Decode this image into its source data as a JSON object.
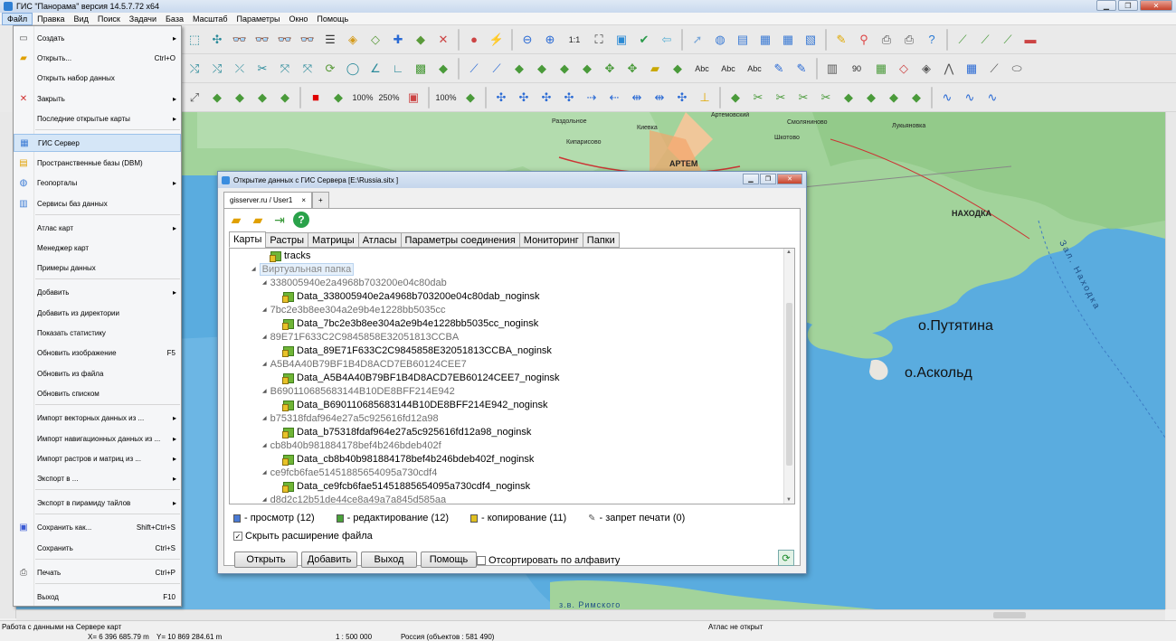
{
  "window": {
    "title": "ГИС \"Панорама\" версия 14.5.7.72 x64"
  },
  "menubar": [
    "Файл",
    "Правка",
    "Вид",
    "Поиск",
    "Задачи",
    "База",
    "Масштаб",
    "Параметры",
    "Окно",
    "Помощь"
  ],
  "file_menu": {
    "items": [
      {
        "label": "Создать",
        "shortcut": "",
        "submenu": true,
        "icon": "document-icon"
      },
      {
        "label": "Открыть...",
        "shortcut": "Ctrl+O",
        "submenu": false,
        "icon": "folder-open-icon"
      },
      {
        "label": "Открыть набор данных",
        "shortcut": "",
        "submenu": false,
        "icon": ""
      },
      {
        "label": "Закрыть",
        "shortcut": "",
        "submenu": true,
        "icon": "close-icon"
      },
      {
        "label": "Последние открытые карты",
        "shortcut": "",
        "submenu": true,
        "icon": ""
      },
      {
        "label": "ГИС Сервер",
        "shortcut": "",
        "submenu": false,
        "icon": "gis-server-icon"
      },
      {
        "label": "Пространственные базы (DBM)",
        "shortcut": "",
        "submenu": false,
        "icon": "database-icon"
      },
      {
        "label": "Геопорталы",
        "shortcut": "",
        "submenu": true,
        "icon": "globe-icon"
      },
      {
        "label": "Сервисы баз данных",
        "shortcut": "",
        "submenu": false,
        "icon": "db-service-icon"
      },
      {
        "label": "Атлас карт",
        "shortcut": "",
        "submenu": true,
        "icon": ""
      },
      {
        "label": "Менеджер карт",
        "shortcut": "",
        "submenu": false,
        "icon": ""
      },
      {
        "label": "Примеры данных",
        "shortcut": "",
        "submenu": false,
        "icon": ""
      },
      {
        "label": "Добавить",
        "shortcut": "",
        "submenu": true,
        "icon": ""
      },
      {
        "label": "Добавить из директории",
        "shortcut": "",
        "submenu": false,
        "icon": ""
      },
      {
        "label": "Показать статистику",
        "shortcut": "",
        "submenu": false,
        "icon": ""
      },
      {
        "label": "Обновить изображение",
        "shortcut": "F5",
        "submenu": false,
        "icon": ""
      },
      {
        "label": "Обновить из файла",
        "shortcut": "",
        "submenu": false,
        "icon": ""
      },
      {
        "label": "Обновить списком",
        "shortcut": "",
        "submenu": false,
        "icon": ""
      },
      {
        "label": "Импорт векторных данных из ...",
        "shortcut": "",
        "submenu": true,
        "icon": ""
      },
      {
        "label": "Импорт навигационных данных из ...",
        "shortcut": "",
        "submenu": true,
        "icon": ""
      },
      {
        "label": "Импорт растров и матриц из ...",
        "shortcut": "",
        "submenu": true,
        "icon": ""
      },
      {
        "label": "Экспорт в ...",
        "shortcut": "",
        "submenu": true,
        "icon": ""
      },
      {
        "label": "Экспорт в пирамиду тайлов",
        "shortcut": "",
        "submenu": true,
        "icon": ""
      },
      {
        "label": "Сохранить как...",
        "shortcut": "Shift+Ctrl+S",
        "submenu": false,
        "icon": "save-icon"
      },
      {
        "label": "Сохранить",
        "shortcut": "Ctrl+S",
        "submenu": false,
        "icon": ""
      },
      {
        "label": "Печать",
        "shortcut": "Ctrl+P",
        "submenu": false,
        "icon": "printer-icon"
      },
      {
        "label": "Выход",
        "shortcut": "F10",
        "submenu": false,
        "icon": ""
      }
    ]
  },
  "toolbar": {
    "zoom_1to1": "1:1",
    "pct100": "100%",
    "pct250": "250%",
    "abc": "Abc",
    "num90": "90"
  },
  "map_labels": {
    "artem": "АРТЕМ",
    "nakhodka": "НАХОДКА",
    "putyatina": "о.Путятина",
    "askold": "о.Аскольд",
    "bay": "Зал. Находка",
    "artemovsky": "Артемовский",
    "smolyaninovo": "Смоляниново",
    "razdolnoe": "Раздольное",
    "kievka": "Киевка",
    "kiparisovo": "Кипарисово",
    "shkotovo": "Шкотово",
    "lukyanovka": "Лукьяновка",
    "rimsky": "з.в. Римского"
  },
  "dialog": {
    "title": "Открытие данных с ГИС Сервера [E:\\Russia.sitx ]",
    "tab": "gisserver.ru / User1",
    "tab_close": "×",
    "tab_plus": "+",
    "inner_tabs": [
      "Карты",
      "Растры",
      "Матрицы",
      "Атласы",
      "Параметры соединения",
      "Мониторинг",
      "Папки"
    ],
    "tree": {
      "tracks": "tracks",
      "virtual_folder": "Виртуальная папка",
      "groups": [
        {
          "folder": "338005940e2a4968b703200e04c80dab",
          "item": "Data_338005940e2a4968b703200e04c80dab_noginsk"
        },
        {
          "folder": "7bc2e3b8ee304a2e9b4e1228bb5035cc",
          "item": "Data_7bc2e3b8ee304a2e9b4e1228bb5035cc_noginsk"
        },
        {
          "folder": "89E71F633C2C9845858E32051813CCBA",
          "item": "Data_89E71F633C2C9845858E32051813CCBA_noginsk"
        },
        {
          "folder": "A5B4A40B79BF1B4D8ACD7EB60124CEE7",
          "item": "Data_A5B4A40B79BF1B4D8ACD7EB60124CEE7_noginsk"
        },
        {
          "folder": "B690110685683144B10DE8BFF214E942",
          "item": "Data_B690110685683144B10DE8BFF214E942_noginsk"
        },
        {
          "folder": "b75318fdaf964e27a5c925616fd12a98",
          "item": "Data_b75318fdaf964e27a5c925616fd12a98_noginsk"
        },
        {
          "folder": "cb8b40b981884178bef4b246bdeb402f",
          "item": "Data_cb8b40b981884178bef4b246bdeb402f_noginsk"
        },
        {
          "folder": "ce9fcb6fae51451885654095a730cdf4",
          "item": "Data_ce9fcb6fae51451885654095a730cdf4_noginsk"
        }
      ],
      "last_folder": "d8d2c12b51de44ce8a49a7a845d585aa"
    },
    "legend": {
      "view": "- просмотр (12)",
      "edit": "- редактирование (12)",
      "copy": "- копирование (11)",
      "noprint": "- запрет печати (0)"
    },
    "hide_ext": "Скрыть расширение файла",
    "buttons": {
      "open": "Открыть",
      "add": "Добавить",
      "exit": "Выход",
      "help": "Помощь"
    },
    "sort": "Отсортировать по алфавиту"
  },
  "status": {
    "left": "Работа с данными на Сервере карт",
    "atlas": "Атлас не открыт",
    "x": "X= 6 396 685.79 m",
    "y": "Y= 10 869 284.61 m",
    "scale": "1 : 500 000",
    "region": "Россия   (объектов : 581 490)"
  },
  "colors": {
    "sea": "#56a8df",
    "land": "#9fd29a",
    "menu_highlight": "#d5e6f7",
    "accent": "#3a8ddf"
  }
}
